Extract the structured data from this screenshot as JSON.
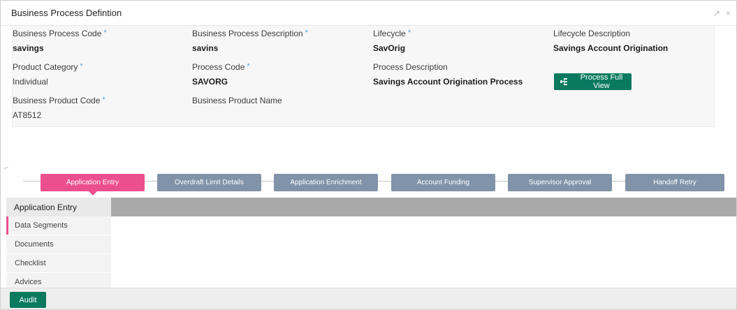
{
  "window": {
    "title": "Business Process Defintion",
    "controls": {
      "restore": "↗",
      "close": "×"
    }
  },
  "fields": {
    "business_process_code": {
      "label": "Business Process Code",
      "value": "savings",
      "required": "*"
    },
    "business_process_description": {
      "label": "Business Process Description",
      "value": "savins",
      "required": "*"
    },
    "lifecycle": {
      "label": "Lifecycle",
      "value": "SavOrig",
      "required": "*"
    },
    "lifecycle_description": {
      "label": "Lifecycle Description",
      "value": "Savings Account Origination"
    },
    "product_category": {
      "label": "Product Category",
      "value": "Individual",
      "required": "*"
    },
    "process_code": {
      "label": "Process Code",
      "value": "SAVORG",
      "required": "*"
    },
    "process_description": {
      "label": "Process Description",
      "value": "Savings Account Origination Process"
    },
    "business_product_code": {
      "label": "Business Product Code",
      "value": "AT8512",
      "required": "*"
    },
    "business_product_name": {
      "label": "Business Product Name",
      "value": ""
    }
  },
  "buttons": {
    "process_full_view": "Process Full View",
    "audit": "Audit"
  },
  "stages": [
    {
      "label": "Application Entry",
      "active": true
    },
    {
      "label": "Overdraft Limit Details",
      "active": false
    },
    {
      "label": "Application Enrichment",
      "active": false
    },
    {
      "label": "Account Funding",
      "active": false
    },
    {
      "label": "Supervisor Approval",
      "active": false
    },
    {
      "label": "Handoff Retry",
      "active": false
    }
  ],
  "section": {
    "title": "Application Entry",
    "items": [
      {
        "label": "Data Segments",
        "active": true
      },
      {
        "label": "Documents",
        "active": false
      },
      {
        "label": "Checklist",
        "active": false
      },
      {
        "label": "Advices",
        "active": false
      }
    ]
  },
  "colors": {
    "accent_green": "#0a7a5f",
    "active_stage_pink": "#ec4f8e",
    "inactive_stage_slate": "#8193a8",
    "required_star": "#55a7d6"
  }
}
